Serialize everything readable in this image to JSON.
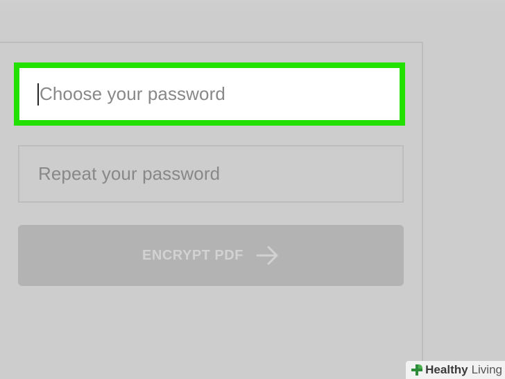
{
  "form": {
    "password_field": {
      "placeholder": "Choose your password",
      "state": "focused",
      "highlight_color": "#22e000"
    },
    "repeat_field": {
      "placeholder": "Repeat your password"
    },
    "submit_button": {
      "label": "ENCRYPT PDF",
      "icon": "arrow-right-icon",
      "state": "disabled"
    }
  },
  "watermark": {
    "icon": "plus-leaf-icon",
    "brand_bold": "Healthy",
    "brand_light": "Living"
  },
  "colors": {
    "background": "#cdcdcd",
    "highlight": "#22e000",
    "button_bg": "#b3b3b3",
    "button_text": "#d2d2d2"
  }
}
